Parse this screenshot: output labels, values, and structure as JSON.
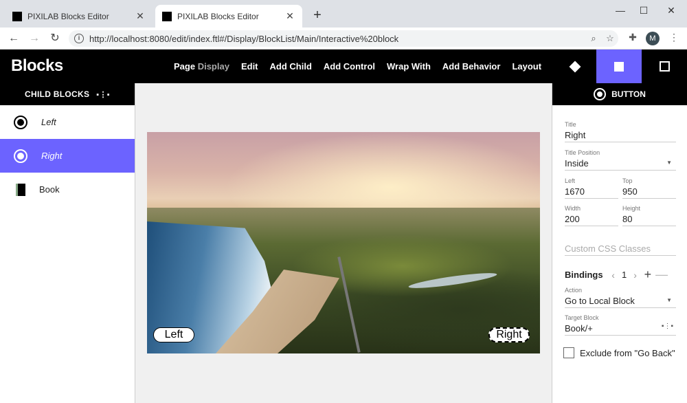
{
  "browser": {
    "tabs": [
      {
        "title": "PIXILAB Blocks Editor",
        "active": false
      },
      {
        "title": "PIXILAB Blocks Editor",
        "active": true
      }
    ],
    "new_tab": "+",
    "url": "http://localhost:8080/edit/index.ftl#/Display/BlockList/Main/Interactive%20block",
    "avatar": "M"
  },
  "app": {
    "logo": "Blocks",
    "menu": {
      "page": "Page",
      "display": "Display",
      "edit": "Edit",
      "add_child": "Add Child",
      "add_control": "Add Control",
      "wrap_with": "Wrap With",
      "add_behavior": "Add Behavior",
      "layout": "Layout"
    }
  },
  "left_panel": {
    "header": "CHILD BLOCKS",
    "items": [
      {
        "label": "Left",
        "icon": "radio-button-icon"
      },
      {
        "label": "Right",
        "icon": "radio-button-icon",
        "selected": true
      },
      {
        "label": "Book",
        "icon": "book-icon"
      }
    ]
  },
  "canvas": {
    "buttons": {
      "left": "Left",
      "right": "Right"
    }
  },
  "right_panel": {
    "header": "BUTTON",
    "title": {
      "label": "Title",
      "value": "Right"
    },
    "title_position": {
      "label": "Title Position",
      "value": "Inside"
    },
    "left": {
      "label": "Left",
      "value": "1670"
    },
    "top": {
      "label": "Top",
      "value": "950"
    },
    "width": {
      "label": "Width",
      "value": "200"
    },
    "height": {
      "label": "Height",
      "value": "80"
    },
    "css_classes": {
      "placeholder": "Custom CSS Classes"
    },
    "bindings": {
      "label": "Bindings",
      "index": "1"
    },
    "action": {
      "label": "Action",
      "value": "Go to Local Block"
    },
    "target_block": {
      "label": "Target Block",
      "value": "Book/+"
    },
    "exclude": {
      "label": "Exclude from \"Go Back\"",
      "checked": false
    }
  },
  "colors": {
    "accent": "#6c63ff",
    "header_bg": "#000000"
  }
}
